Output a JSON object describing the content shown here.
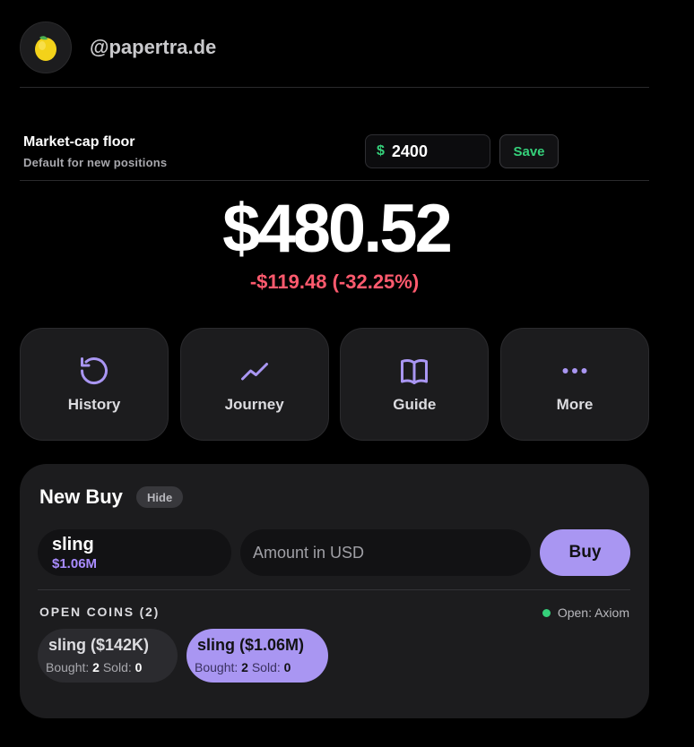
{
  "header": {
    "handle": "@papertra.de",
    "avatar_icon": "lemon-icon"
  },
  "floor": {
    "title": "Market-cap floor",
    "subtitle": "Default for new positions",
    "currency_symbol": "$",
    "value": "2400",
    "save_label": "Save"
  },
  "portfolio": {
    "balance": "$480.52",
    "change": "-$119.48 (-32.25%)",
    "change_color": "#ff5a6e"
  },
  "actions": [
    {
      "label": "History",
      "icon": "history-icon"
    },
    {
      "label": "Journey",
      "icon": "trend-line-icon"
    },
    {
      "label": "Guide",
      "icon": "book-icon"
    },
    {
      "label": "More",
      "icon": "more-dots-icon"
    }
  ],
  "new_buy": {
    "title": "New Buy",
    "hide_label": "Hide",
    "selected_coin": {
      "name": "sling",
      "market_cap": "$1.06M"
    },
    "amount_placeholder": "Amount in USD",
    "buy_label": "Buy",
    "open_coins_label": "OPEN COINS (2)",
    "open_status": "Open: Axiom",
    "coins": [
      {
        "name": "sling ($142K)",
        "bought_label": "Bought:",
        "bought": "2",
        "sold_label": "Sold:",
        "sold": "0",
        "selected": false
      },
      {
        "name": "sling ($1.06M)",
        "bought_label": "Bought:",
        "bought": "2",
        "sold_label": "Sold:",
        "sold": "0",
        "selected": true
      }
    ]
  },
  "colors": {
    "accent": "#a996f2",
    "positive": "#35d07a",
    "negative": "#ff5a6e",
    "card_bg": "#1c1c1e"
  }
}
